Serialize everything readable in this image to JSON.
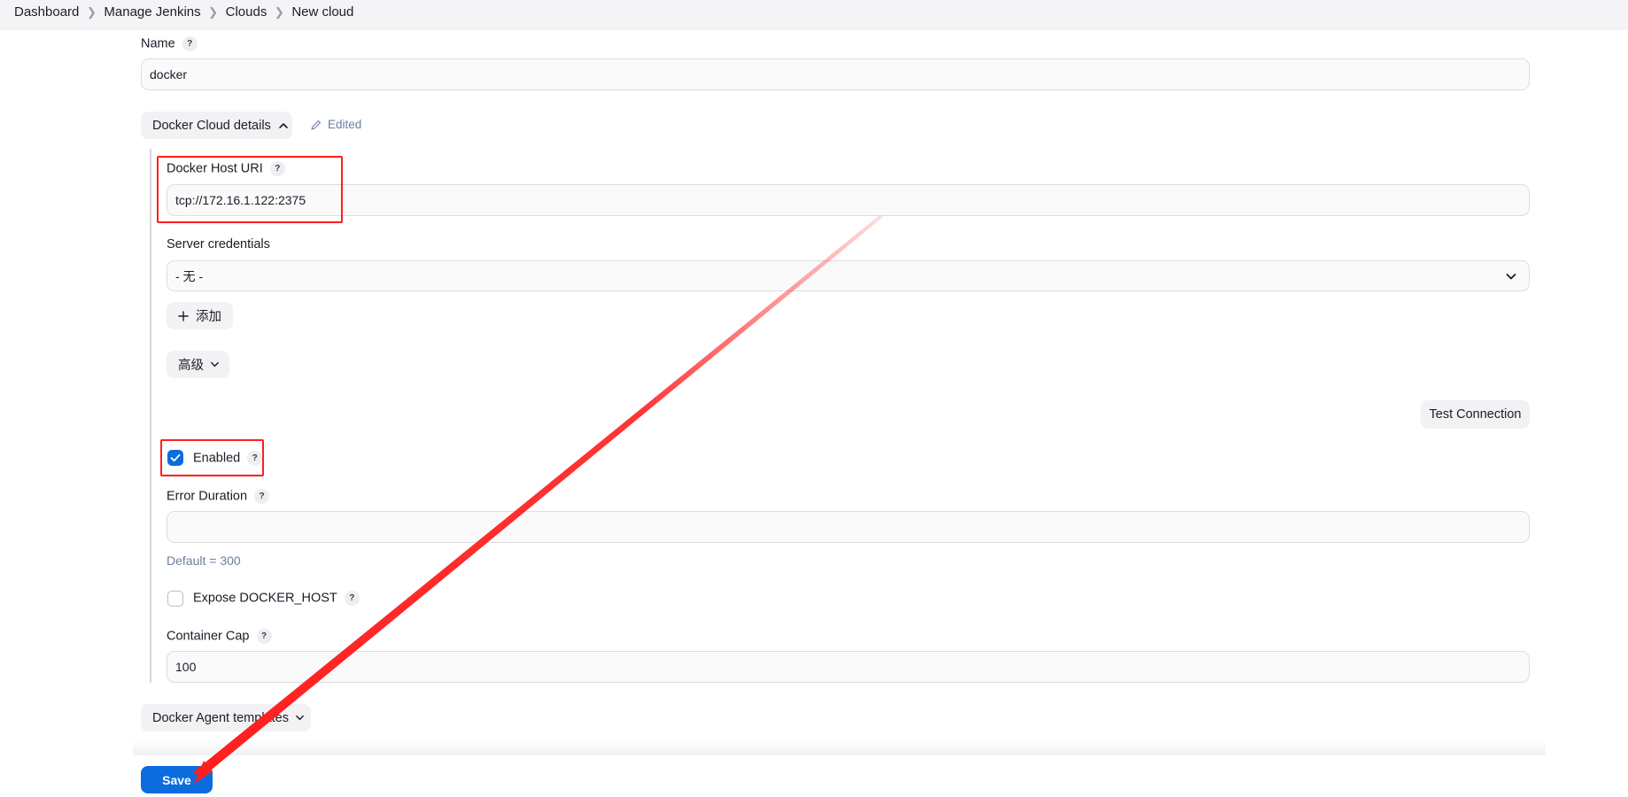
{
  "breadcrumb": {
    "items": [
      "Dashboard",
      "Manage Jenkins",
      "Clouds",
      "New cloud"
    ]
  },
  "form": {
    "name_label": "Name",
    "name_value": "docker",
    "section_docker_cloud": "Docker Cloud details",
    "edited_label": "Edited",
    "docker_host_uri_label": "Docker Host URI",
    "docker_host_uri_value": "tcp://172.16.1.122:2375",
    "server_credentials_label": "Server credentials",
    "server_credentials_value": "- 无 -",
    "add_label": "添加",
    "advanced_label": "高级",
    "test_connection_label": "Test Connection",
    "enabled_label": "Enabled",
    "enabled_checked": true,
    "error_duration_label": "Error Duration",
    "error_duration_value": "",
    "error_duration_hint": "Default = 300",
    "expose_docker_host_label": "Expose DOCKER_HOST",
    "expose_docker_host_checked": false,
    "container_cap_label": "Container Cap",
    "container_cap_value": "100",
    "section_agent_templates": "Docker Agent templates",
    "save_label": "Save",
    "help_glyph": "?"
  },
  "annotation": {
    "highlight_color": "#ff1e1e"
  },
  "colors": {
    "accent": "#0b6cde",
    "edited": "#6a7fa0"
  }
}
